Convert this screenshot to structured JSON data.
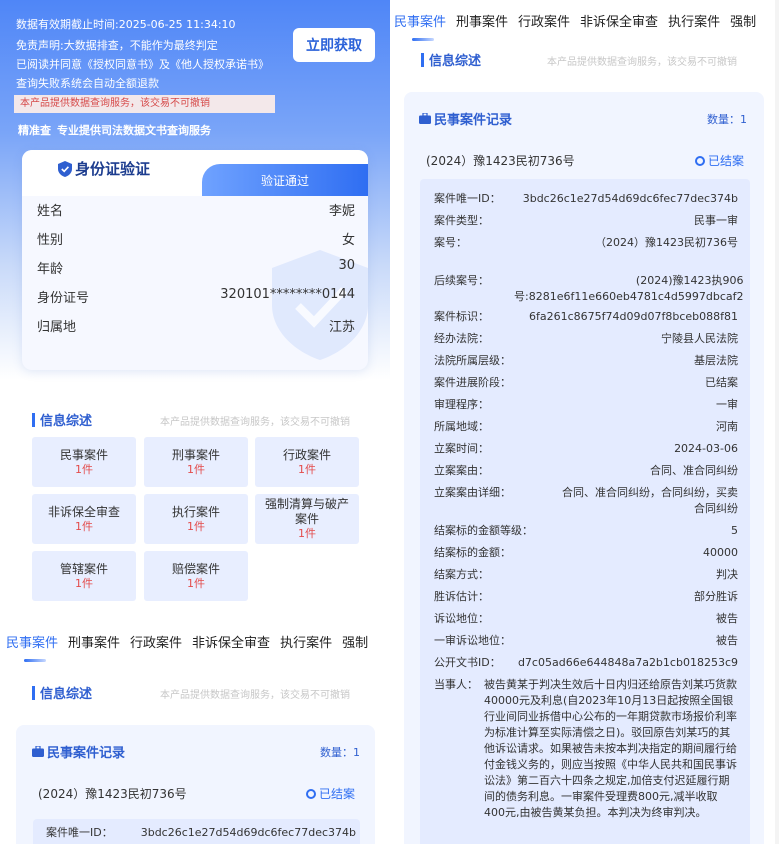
{
  "hero": {
    "expiry": "数据有效期截止时间:2025-06-25 11:34:10",
    "disclaimer": "免责声明:大数据排查，不能作为最终判定",
    "consent": "已阅读并同意《授权同意书》及《他人授权承诺书》",
    "refund": "查询失败系统会自动全额退款",
    "warning": "本产品提供数据查询服务，该交易不可撤销",
    "tag_a": "精准查",
    "tag_b": "专业提供司法数据文书查询服务",
    "get_button": "立即获取"
  },
  "id_card": {
    "title": "身份证验证",
    "status": "验证通过",
    "rows": [
      {
        "label": "姓名",
        "value": "李妮"
      },
      {
        "label": "性别",
        "value": "女"
      },
      {
        "label": "年龄",
        "value": "30"
      },
      {
        "label": "身份证号",
        "value": "320101********0144"
      },
      {
        "label": "归属地",
        "value": "江苏"
      }
    ]
  },
  "overview": {
    "title": "信息综述",
    "note": "本产品提供数据查询服务，该交易不可撤销",
    "cells": [
      {
        "name": "民事案件",
        "count": "1件"
      },
      {
        "name": "刑事案件",
        "count": "1件"
      },
      {
        "name": "行政案件",
        "count": "1件"
      },
      {
        "name": "非诉保全审查",
        "count": "1件"
      },
      {
        "name": "执行案件",
        "count": "1件"
      },
      {
        "name": "强制清算与破产案件",
        "count": "1件"
      },
      {
        "name": "管辖案件",
        "count": "1件"
      },
      {
        "name": "赔偿案件",
        "count": "1件"
      }
    ]
  },
  "tabs": [
    "民事案件",
    "刑事案件",
    "行政案件",
    "非诉保全审查",
    "执行案件",
    "强制"
  ],
  "case": {
    "title": "民事案件记录",
    "count": "数量：1",
    "number": "(2024）豫1423民初736号",
    "status": "已结案",
    "details": [
      {
        "k": "案件唯一ID：",
        "v": "3bdc26c1e27d54d69dc6fec77dec374b"
      },
      {
        "k": "案件类型：",
        "v": "民事一审"
      },
      {
        "k": "案号：",
        "v": "（2024）豫1423民初736号"
      },
      {
        "k": "后续案号：",
        "v": "(2024)豫1423执906号:8281e6f11e660eb4781c4d5997dbcaf2"
      },
      {
        "k": "案件标识：",
        "v": "6fa261c8675f74d09d07f8bceb088f81"
      },
      {
        "k": "经办法院：",
        "v": "宁陵县人民法院"
      },
      {
        "k": "法院所属层级：",
        "v": "基层法院"
      },
      {
        "k": "案件进展阶段：",
        "v": "已结案"
      },
      {
        "k": "审理程序：",
        "v": "一审"
      },
      {
        "k": "所属地域：",
        "v": "河南"
      },
      {
        "k": "立案时间：",
        "v": "2024-03-06"
      },
      {
        "k": "立案案由：",
        "v": "合同、准合同纠纷"
      },
      {
        "k": "立案案由详细：",
        "v": "合同、准合同纠纷，合同纠纷，买卖合同纠纷"
      },
      {
        "k": "结案标的金额等级：",
        "v": "5"
      },
      {
        "k": "结案标的金额：",
        "v": "40000"
      },
      {
        "k": "结案方式：",
        "v": "判决"
      },
      {
        "k": "胜诉估计：",
        "v": "部分胜诉"
      },
      {
        "k": "诉讼地位：",
        "v": "被告"
      },
      {
        "k": "一审诉讼地位：",
        "v": "被告"
      },
      {
        "k": "公开文书ID：",
        "v": "d7c05ad66e644848a7a2b1cb018253c9"
      },
      {
        "k": "当事人：",
        "v": "被告黄某于判决生效后十日内归还给原告刘某巧货款40000元及利息(自2023年10月13日起按照全国银行业间同业拆借中心公布的一年期贷款市场报价利率为标准计算至实际清偿之日)。驳回原告刘某巧的其他诉讼请求。如果被告未按本判决指定的期间履行给付金钱义务的，则应当按照《中华人民共和国民事诉讼法》第二百六十四条之规定,加倍支付迟延履行期间的债务利息。一审案件受理费800元,减半收取400元,由被告黄某负担。本判决为终审判决。"
      }
    ]
  },
  "colors": {
    "accent": "#2f6ef2",
    "count_red": "#e34b4b",
    "warning_bg": "#f3e8ea"
  }
}
